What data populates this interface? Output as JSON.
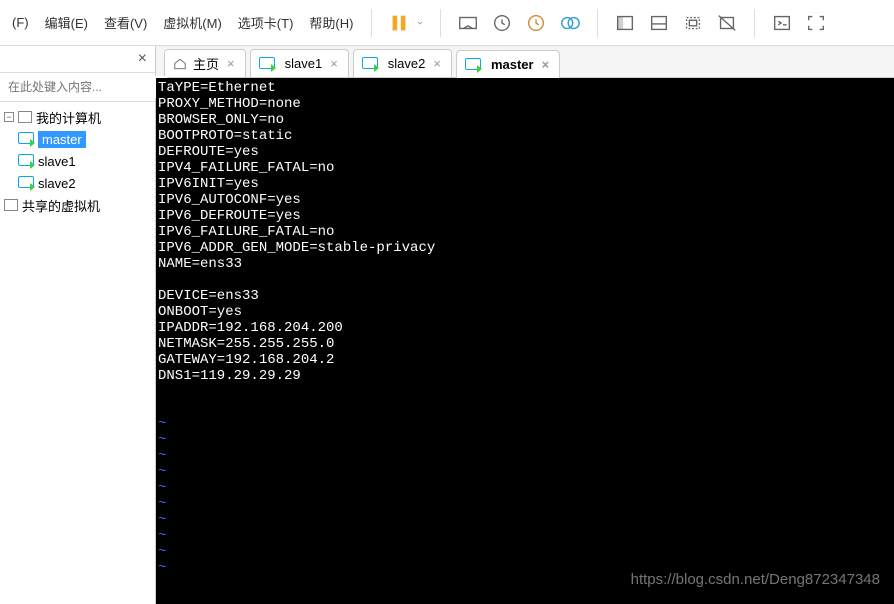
{
  "menu": {
    "file": "(F)",
    "edit": "编辑(E)",
    "view": "查看(V)",
    "vm": "虚拟机(M)",
    "tabs": "选项卡(T)",
    "help": "帮助(H)"
  },
  "sidebar": {
    "search_placeholder": "在此处键入内容...",
    "root_label": "我的计算机",
    "vms": [
      {
        "label": "master",
        "selected": true
      },
      {
        "label": "slave1",
        "selected": false
      },
      {
        "label": "slave2",
        "selected": false
      }
    ],
    "shared_label": "共享的虚拟机"
  },
  "tabs": [
    {
      "label": "主页",
      "type": "home",
      "active": false
    },
    {
      "label": "slave1",
      "type": "vm",
      "active": false
    },
    {
      "label": "slave2",
      "type": "vm",
      "active": false
    },
    {
      "label": "master",
      "type": "vm",
      "active": true
    }
  ],
  "terminal": {
    "lines": [
      "TaYPE=Ethernet",
      "PROXY_METHOD=none",
      "BROWSER_ONLY=no",
      "BOOTPROTO=static",
      "DEFROUTE=yes",
      "IPV4_FAILURE_FATAL=no",
      "IPV6INIT=yes",
      "IPV6_AUTOCONF=yes",
      "IPV6_DEFROUTE=yes",
      "IPV6_FAILURE_FATAL=no",
      "IPV6_ADDR_GEN_MODE=stable-privacy",
      "NAME=ens33",
      "",
      "DEVICE=ens33",
      "ONBOOT=yes",
      "IPADDR=192.168.204.200",
      "NETMASK=255.255.255.0",
      "GATEWAY=192.168.204.2",
      "DNS1=119.29.29.29"
    ],
    "tilde_count": 10
  },
  "watermark": "https://blog.csdn.net/Deng872347348"
}
